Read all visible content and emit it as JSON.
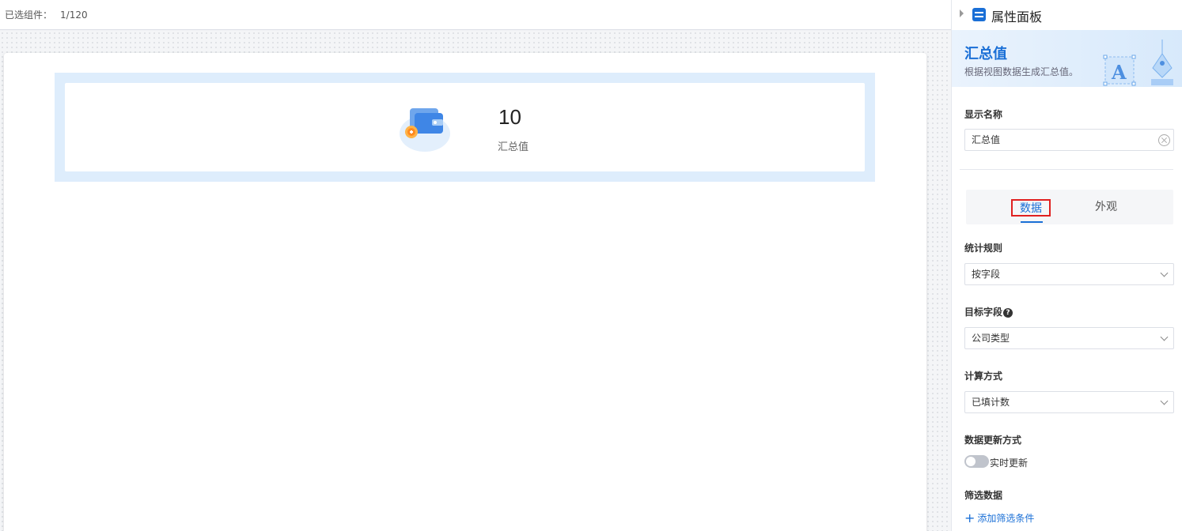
{
  "topbar": {
    "selected_label": "已选组件：",
    "selected_count": "1/120"
  },
  "widget": {
    "value": "10",
    "label": "汇总值",
    "icon": "wallet-icon"
  },
  "panel": {
    "title": "属性面板",
    "banner": {
      "title": "汇总值",
      "subtitle": "根据视图数据生成汇总值。"
    },
    "display_name": {
      "label": "显示名称",
      "value": "汇总值"
    },
    "tabs": [
      {
        "label": "数据",
        "active": true
      },
      {
        "label": "外观",
        "active": false
      }
    ],
    "stat_rule": {
      "label": "统计规则",
      "value": "按字段"
    },
    "target_field": {
      "label": "目标字段",
      "value": "公司类型",
      "help": "?"
    },
    "calc_method": {
      "label": "计算方式",
      "value": "已填计数"
    },
    "update_mode": {
      "label": "数据更新方式",
      "toggle_label": "实时更新",
      "enabled": false
    },
    "filter": {
      "label": "筛选数据",
      "add_label": "添加筛选条件"
    }
  },
  "colors": {
    "accent": "#1a6fd6",
    "highlight_border": "#e02020",
    "widget_frame": "#deedfc"
  }
}
